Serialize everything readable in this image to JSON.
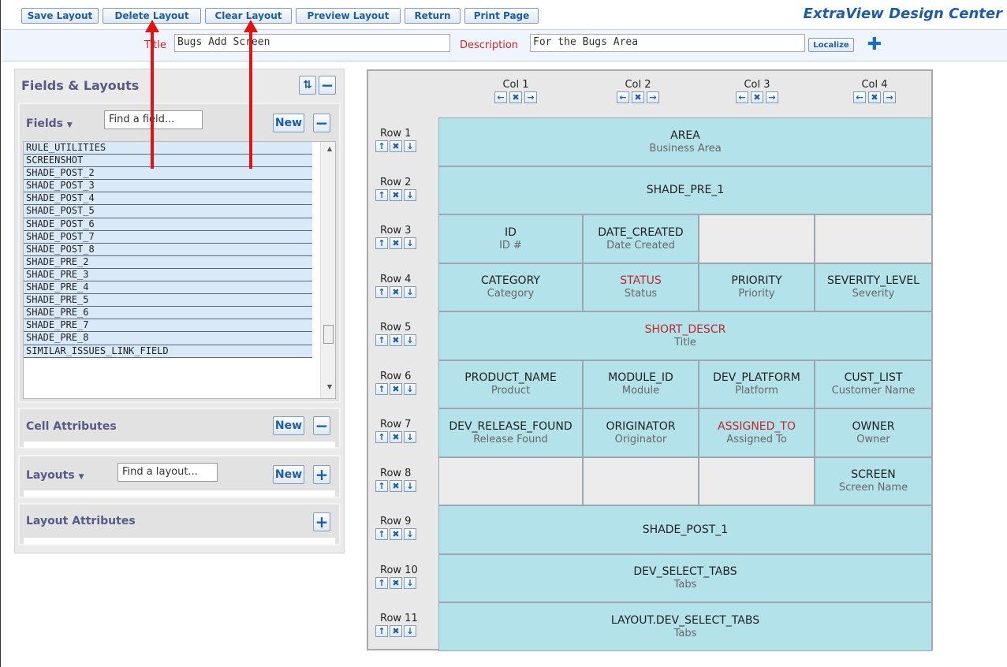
{
  "toolbar": {
    "buttons": [
      "Save Layout",
      "Delete Layout",
      "Clear Layout",
      "Preview Layout",
      "Return",
      "Print Page"
    ],
    "brand": "ExtraView Design Center"
  },
  "title_bar": {
    "title_label": "Title",
    "title_value": "Bugs Add Screen",
    "description_label": "Description",
    "description_value": "For the Bugs Area",
    "localize_label": "Localize",
    "add_icon": "plus-icon"
  },
  "left_panel": {
    "title": "Fields & Layouts",
    "fields": {
      "header": "Fields",
      "find_placeholder": "Find a field...",
      "new_label": "New",
      "items": [
        "RULE_UTILITIES",
        "SCREENSHOT",
        "SHADE_POST_2",
        "SHADE_POST_3",
        "SHADE_POST_4",
        "SHADE_POST_5",
        "SHADE_POST_6",
        "SHADE_POST_7",
        "SHADE_POST_8",
        "SHADE_PRE_2",
        "SHADE_PRE_3",
        "SHADE_PRE_4",
        "SHADE_PRE_5",
        "SHADE_PRE_6",
        "SHADE_PRE_7",
        "SHADE_PRE_8",
        "SIMILAR_ISSUES_LINK_FIELD"
      ]
    },
    "cell_attributes": {
      "header": "Cell Attributes",
      "new_label": "New"
    },
    "layouts": {
      "header": "Layouts",
      "find_placeholder": "Find a layout...",
      "new_label": "New"
    },
    "layout_attributes": {
      "header": "Layout Attributes"
    }
  },
  "grid": {
    "columns": [
      "Col 1",
      "Col 2",
      "Col 3",
      "Col 4"
    ],
    "rows": [
      {
        "label": "Row 1",
        "cells": [
          {
            "name": "AREA",
            "label": "Business Area",
            "span": 4,
            "required": false
          }
        ]
      },
      {
        "label": "Row 2",
        "cells": [
          {
            "name": "SHADE_PRE_1",
            "label": "",
            "span": 4,
            "required": false
          }
        ]
      },
      {
        "label": "Row 3",
        "cells": [
          {
            "name": "ID",
            "label": "ID #",
            "span": 1,
            "required": false
          },
          {
            "name": "DATE_CREATED",
            "label": "Date Created",
            "span": 1,
            "required": false
          },
          {
            "empty": true,
            "span": 1
          },
          {
            "empty": true,
            "span": 1
          }
        ]
      },
      {
        "label": "Row 4",
        "cells": [
          {
            "name": "CATEGORY",
            "label": "Category",
            "span": 1,
            "required": false
          },
          {
            "name": "STATUS",
            "label": "Status",
            "span": 1,
            "required": true
          },
          {
            "name": "PRIORITY",
            "label": "Priority",
            "span": 1,
            "required": false
          },
          {
            "name": "SEVERITY_LEVEL",
            "label": "Severity",
            "span": 1,
            "required": false
          }
        ]
      },
      {
        "label": "Row 5",
        "cells": [
          {
            "name": "SHORT_DESCR",
            "label": "Title",
            "span": 4,
            "required": true
          }
        ]
      },
      {
        "label": "Row 6",
        "cells": [
          {
            "name": "PRODUCT_NAME",
            "label": "Product",
            "span": 1,
            "required": false
          },
          {
            "name": "MODULE_ID",
            "label": "Module",
            "span": 1,
            "required": false
          },
          {
            "name": "DEV_PLATFORM",
            "label": "Platform",
            "span": 1,
            "required": false
          },
          {
            "name": "CUST_LIST",
            "label": "Customer Name",
            "span": 1,
            "required": false
          }
        ]
      },
      {
        "label": "Row 7",
        "cells": [
          {
            "name": "DEV_RELEASE_FOUND",
            "label": "Release Found",
            "span": 1,
            "required": false
          },
          {
            "name": "ORIGINATOR",
            "label": "Originator",
            "span": 1,
            "required": false
          },
          {
            "name": "ASSIGNED_TO",
            "label": "Assigned To",
            "span": 1,
            "required": true
          },
          {
            "name": "OWNER",
            "label": "Owner",
            "span": 1,
            "required": false
          }
        ]
      },
      {
        "label": "Row 8",
        "cells": [
          {
            "empty": true,
            "span": 1
          },
          {
            "empty": true,
            "span": 1
          },
          {
            "empty": true,
            "span": 1
          },
          {
            "name": "SCREEN",
            "label": "Screen Name",
            "span": 1,
            "required": false
          }
        ]
      },
      {
        "label": "Row 9",
        "cells": [
          {
            "name": "SHADE_POST_1",
            "label": "",
            "span": 4,
            "required": false
          }
        ]
      },
      {
        "label": "Row 10",
        "cells": [
          {
            "name": "DEV_SELECT_TABS",
            "label": "Tabs",
            "span": 4,
            "required": false
          }
        ]
      },
      {
        "label": "Row 11",
        "cells": [
          {
            "name": "LAYOUT.DEV_SELECT_TABS",
            "label": "Tabs",
            "span": 4,
            "required": false
          }
        ]
      }
    ]
  },
  "colors": {
    "required": "#c0262d",
    "cell_fill": "#b3e2ea",
    "brand": "#1f5ca8",
    "annotation_arrow": "#e01414"
  }
}
